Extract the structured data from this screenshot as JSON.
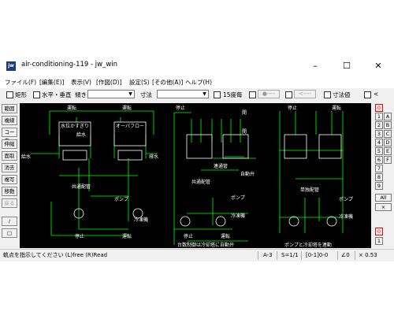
{
  "window": {
    "title": "air-conditioning-119 - jw_win",
    "app_icon_text": "jw",
    "minimize_glyph": "–",
    "maximize_glyph": "☐",
    "close_glyph": "✕"
  },
  "menu": [
    "ファイル(F)",
    "[編集(E)]",
    "表示(V)",
    "[作図(D)]",
    "設定(S)",
    "[その他(A)]",
    "ヘルプ(H)"
  ],
  "toolbar": {
    "rect_label": "矩形",
    "hv_label": "水平・垂直",
    "tilt_label": "傾き",
    "dim_label": "寸法",
    "deg15_label": "15度毎",
    "circle_btn": "●----",
    "arrow_btn": "<----",
    "dimval_label": "寸法値",
    "lt_label": "<"
  },
  "left_tools": [
    "範囲",
    "複線",
    "コーナー",
    "伸縮",
    "面取",
    "消去",
    "複写",
    "移動",
    "戻る",
    "/",
    "□"
  ],
  "right_tools": {
    "col1": [
      "0",
      "1",
      "2",
      "3",
      "4",
      "5",
      "6",
      "7",
      "8",
      "9"
    ],
    "col2": [
      "A",
      "B",
      "C",
      "D",
      "E",
      "F"
    ],
    "all_label": "All",
    "x_label": "×",
    "bottom": [
      "0",
      "1"
    ]
  },
  "drawing": {
    "labels": {
      "run_1": "運転",
      "run_2": "運転",
      "water_gauge": "水位かすぎり",
      "overflow": "オーバフロー",
      "supply": "給水",
      "supply_in": "給水",
      "drain": "排水",
      "common_pipe": "共通配管",
      "pump_1": "ポンプ",
      "cooling_1": "冷凍機",
      "stop_1": "停止",
      "run_3": "運転",
      "stop_2": "停止",
      "open_1": "開",
      "open_2": "開",
      "connect": "連通管",
      "auto_valve": "自動弁",
      "common_pipe_2": "共通配管",
      "pump_2": "ポンプ",
      "cooling_2": "冷凍機",
      "stop_3": "停止",
      "run_4": "運転",
      "note_1": "台数制御は冷却塔に自動弁",
      "stop_4": "停止",
      "run_5": "運転",
      "indiv_pipe": "単独配管",
      "pump_3": "ポンプ",
      "cooling_3": "冷凍機",
      "note_2": "ポンプと冷却塔を連動"
    }
  },
  "status": {
    "message": "軌点を指示してください (L)free (R)Read",
    "paper": "A-3",
    "scale": "S=1/1",
    "layer": "[0-1]0-0",
    "angle": "∠0",
    "zoom": "× 0.53"
  },
  "colors": {
    "canvas_bg": "#000000",
    "line_white": "#ffffff",
    "line_green": "#00ff00",
    "active_red": "#ff0000"
  }
}
